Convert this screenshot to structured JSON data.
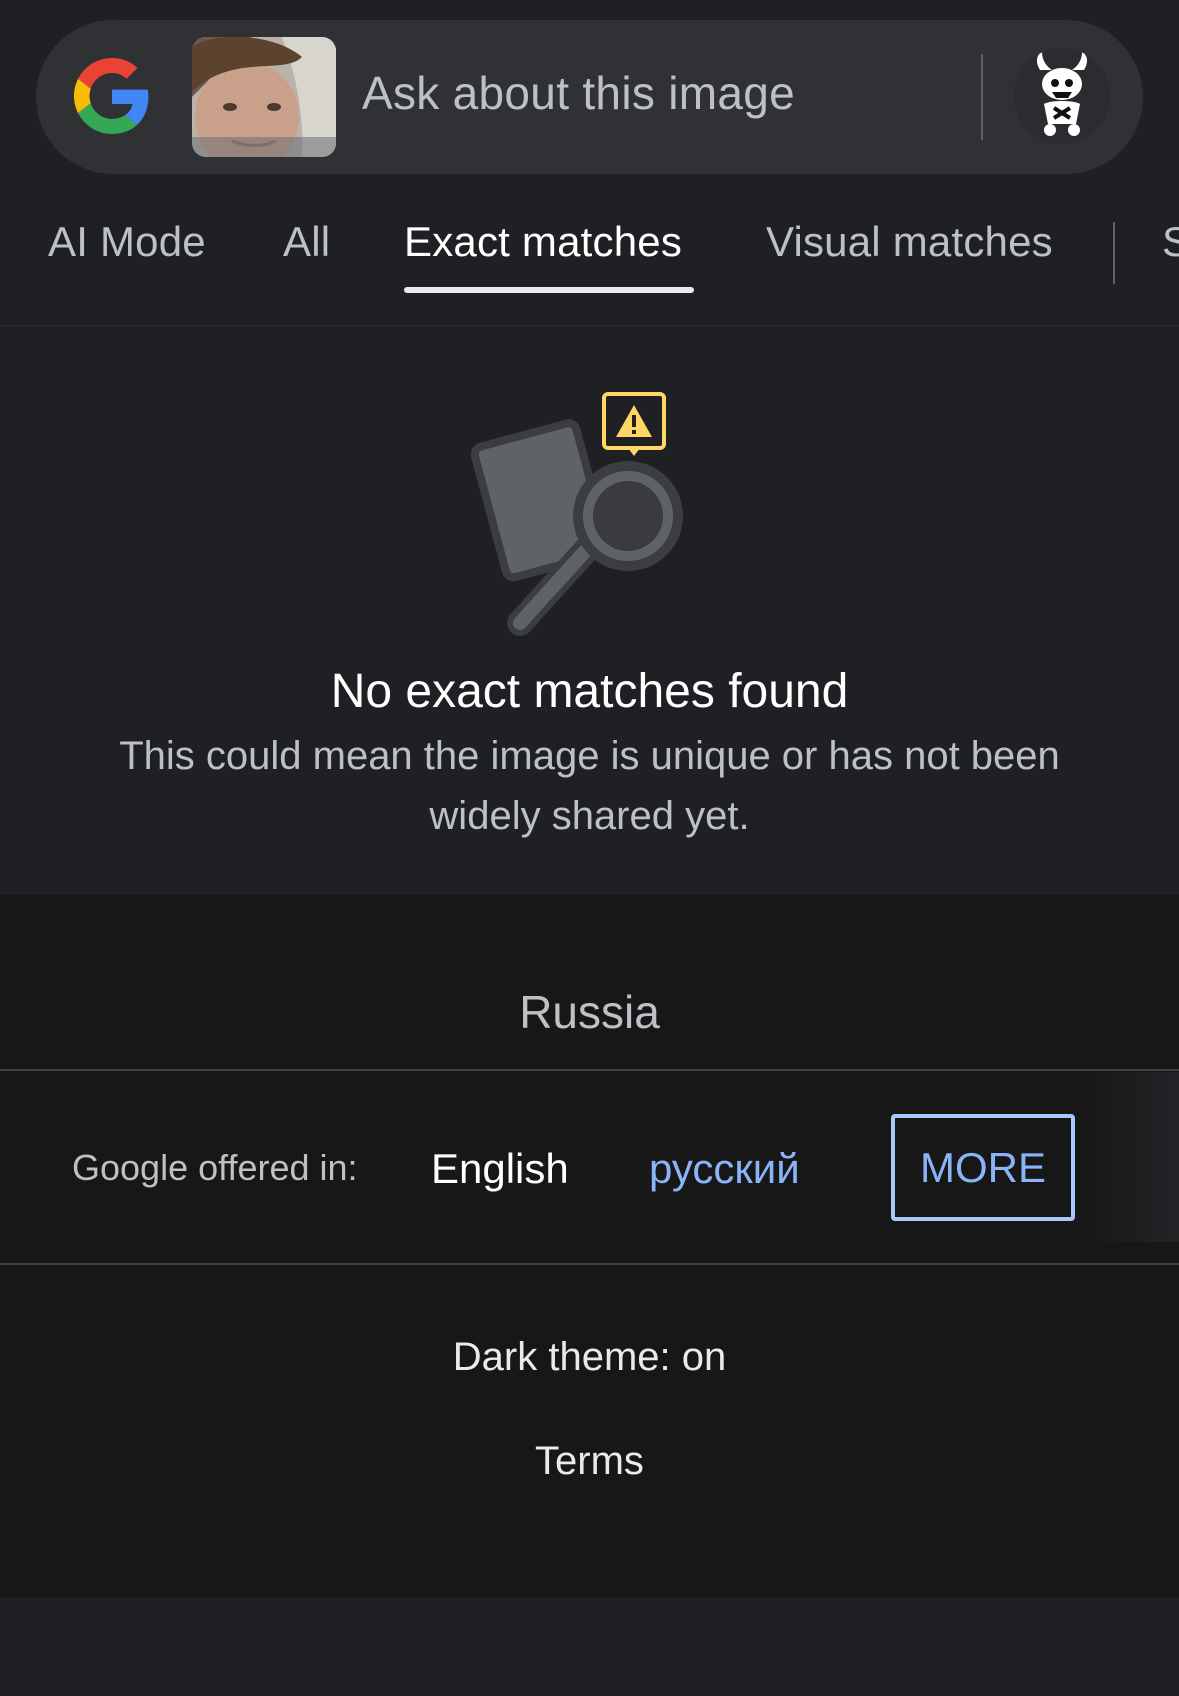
{
  "search_bar": {
    "placeholder": "Ask about this image",
    "logo_icon": "google-g-icon",
    "thumbnail": "query-image-thumbnail",
    "avatar_icon": "account-avatar"
  },
  "tabs": [
    {
      "label": "AI Mode",
      "active": false
    },
    {
      "label": "All",
      "active": false
    },
    {
      "label": "Exact matches",
      "active": true
    },
    {
      "label": "Visual matches",
      "active": false
    },
    {
      "label": "S",
      "active": false
    }
  ],
  "empty_state": {
    "icon": "no-matches-search-icon",
    "title": "No exact matches found",
    "description": "This could mean the image is unique or has not been widely shared yet."
  },
  "footer": {
    "region": "Russia",
    "offered_label": "Google offered in:",
    "languages": [
      "English",
      "русский"
    ],
    "more_label": "MORE",
    "dark_theme": "Dark theme: on",
    "terms": "Terms"
  },
  "colors": {
    "background": "#1f2023",
    "search_bar": "#303134",
    "footer": "#171717",
    "link": "#8ab4f8",
    "warning": "#fdd663"
  }
}
